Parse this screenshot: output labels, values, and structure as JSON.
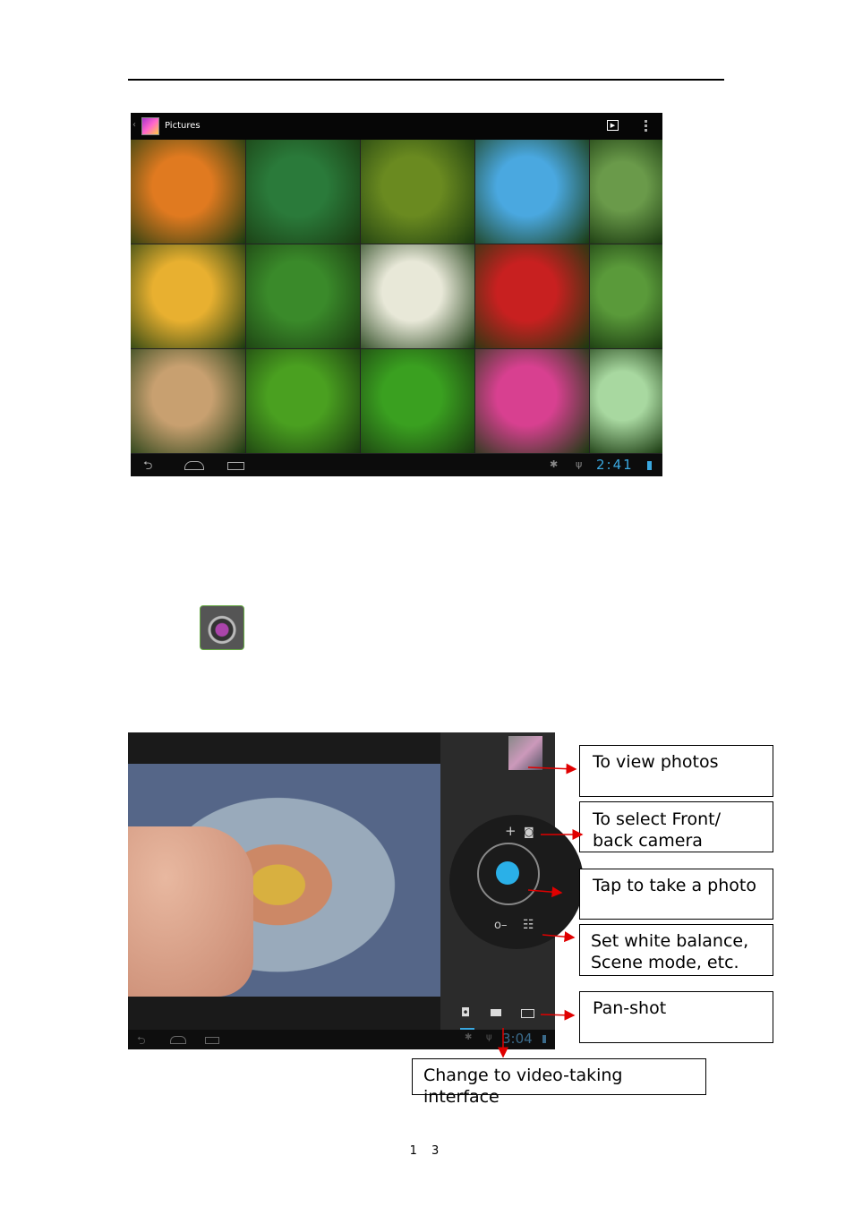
{
  "gallery": {
    "title": "Pictures",
    "clock": "2:41",
    "tiles": [
      "#e07a20",
      "#2a7a3a",
      "#6a8a20",
      "#4aa8e0",
      "#6a9a4a",
      "#e8b030",
      "#3a8a2a",
      "#e8e8d8",
      "#c82020",
      "#5a9a3a",
      "#c8a070",
      "#4aa020",
      "#3aa020",
      "#d84090",
      "#a8d8a0"
    ],
    "icons": [
      "back-icon",
      "home-icon",
      "recent-apps-icon",
      "slideshow-icon",
      "overflow-menu-icon",
      "android-debug-icon",
      "usb-icon",
      "battery-icon"
    ]
  },
  "camera": {
    "clock": "3:04"
  },
  "callouts": {
    "view_photos": "To view photos",
    "front_back": "To select Front/ back camera",
    "take_photo": "Tap to take a photo",
    "white_balance": "Set white balance, Scene mode, etc.",
    "pan_shot": "Pan-shot",
    "video": "Change to video-taking interface"
  },
  "page_number": "1 3",
  "colors": {
    "arrow": "#e00000",
    "shutter": "#2ab0e8",
    "clock": "#3aa8e0"
  }
}
